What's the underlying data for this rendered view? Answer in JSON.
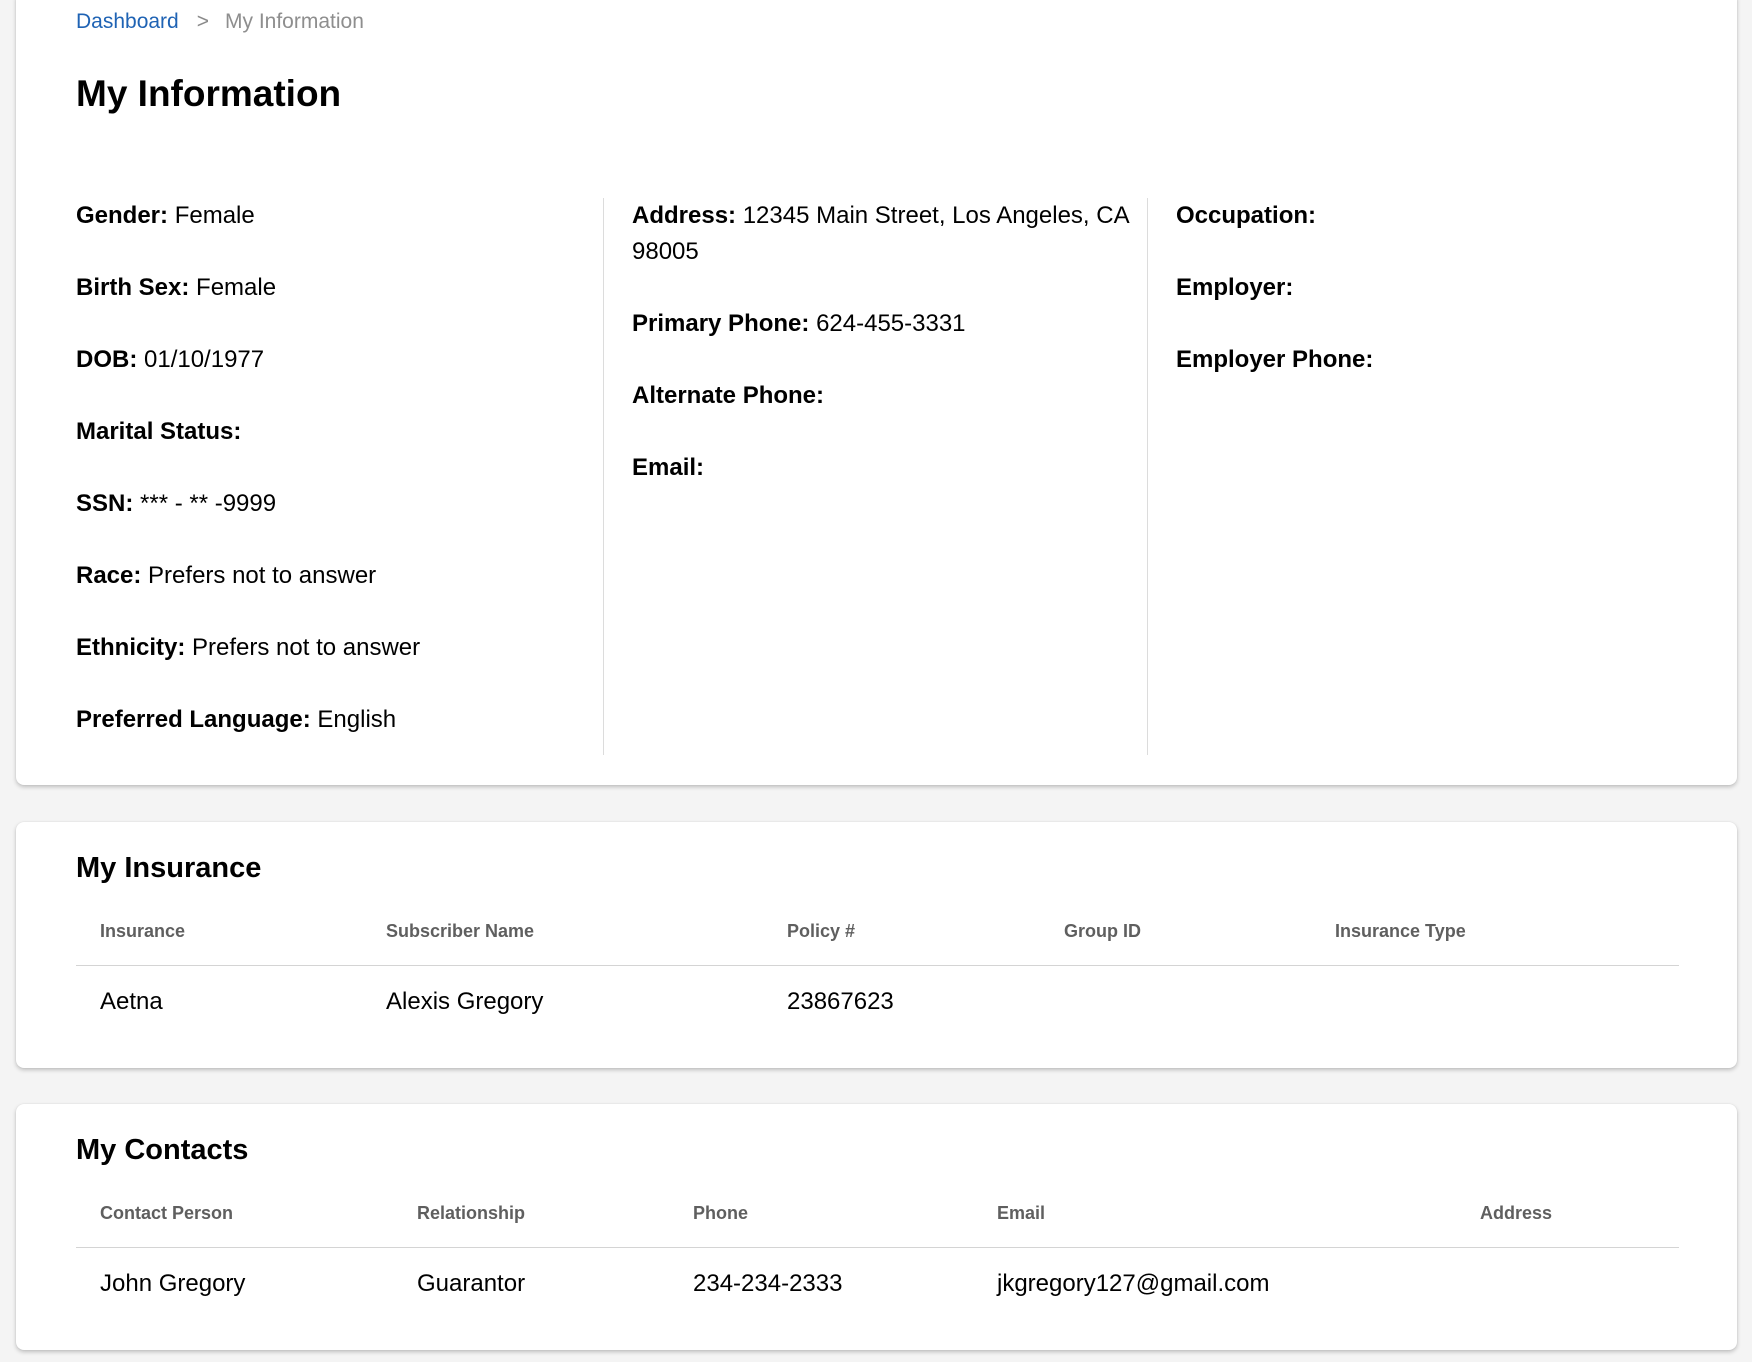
{
  "breadcrumb": {
    "home": "Dashboard",
    "separator": ">",
    "current": "My Information"
  },
  "page_title": "My Information",
  "info": {
    "col1": [
      {
        "label": "Gender:",
        "value": "Female"
      },
      {
        "label": "Birth Sex:",
        "value": "Female"
      },
      {
        "label": "DOB:",
        "value": "01/10/1977"
      },
      {
        "label": "Marital Status:",
        "value": ""
      },
      {
        "label": "SSN:",
        "value": "*** - ** -9999"
      },
      {
        "label": "Race:",
        "value": "Prefers not to answer"
      },
      {
        "label": "Ethnicity:",
        "value": "Prefers not to answer"
      },
      {
        "label": "Preferred Language:",
        "value": "English"
      }
    ],
    "col2": [
      {
        "label": "Address:",
        "value": "12345 Main Street, Los Angeles, CA 98005"
      },
      {
        "label": "Primary Phone:",
        "value": "624-455-3331"
      },
      {
        "label": "Alternate Phone:",
        "value": ""
      },
      {
        "label": "Email:",
        "value": ""
      }
    ],
    "col3": [
      {
        "label": "Occupation:",
        "value": ""
      },
      {
        "label": "Employer:",
        "value": ""
      },
      {
        "label": "Employer Phone:",
        "value": ""
      }
    ]
  },
  "insurance": {
    "title": "My Insurance",
    "headers": [
      "Insurance",
      "Subscriber Name",
      "Policy #",
      "Group ID",
      "Insurance Type"
    ],
    "rows": [
      [
        "Aetna",
        "Alexis Gregory",
        "23867623",
        "",
        ""
      ]
    ]
  },
  "contacts": {
    "title": "My Contacts",
    "headers": [
      "Contact Person",
      "Relationship",
      "Phone",
      "Email",
      "Address"
    ],
    "rows": [
      [
        "John Gregory",
        "Guarantor",
        "234-234-2333",
        "jkgregory127@gmail.com",
        ""
      ]
    ]
  },
  "colors": {
    "link": "#1f63b4",
    "background": "#f4f4f4",
    "card": "#ffffff",
    "header_text": "#5f5f5f"
  }
}
